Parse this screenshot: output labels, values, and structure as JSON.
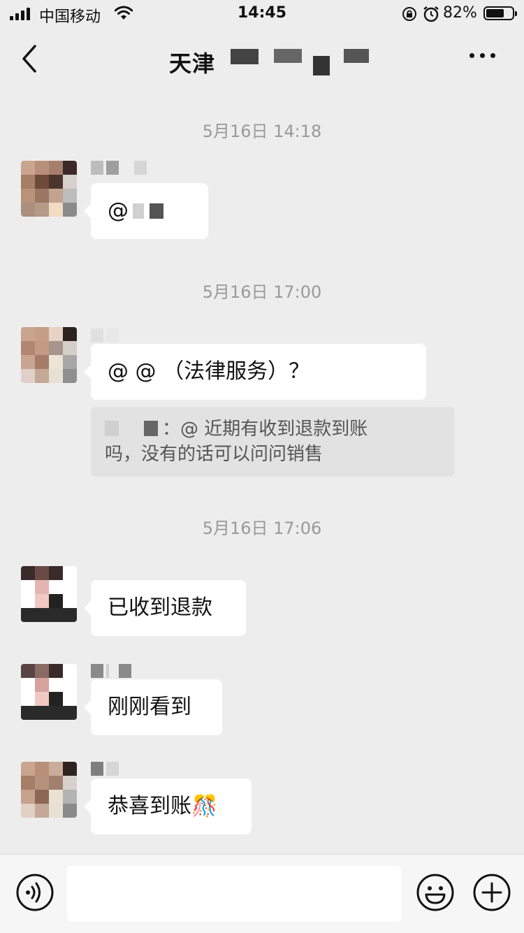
{
  "status_bar": {
    "carrier": "中国移动",
    "time": "14:45",
    "battery": "82%",
    "battery_level": 0.82
  },
  "header": {
    "title": "天津",
    "back_icon": "chevron-left-icon",
    "more_icon": "more-dots-icon"
  },
  "messages": [
    {
      "timestamp": "5月16日 14:18",
      "text": "@"
    },
    {
      "timestamp": "5月16日 17:00",
      "text": "@      @     （法律服务）？",
      "quote": {
        "line1": "：@      近期有收到退款到账",
        "line2": "吗，没有的话可以问问销售"
      }
    },
    {
      "timestamp": "5月16日 17:06",
      "text": "已收到退款"
    },
    {
      "text": "刚刚看到"
    },
    {
      "text": "恭喜到账🎊"
    }
  ],
  "input_bar": {
    "placeholder": "",
    "voice_icon": "voice-icon",
    "emoji_icon": "emoji-icon",
    "plus_icon": "plus-icon"
  },
  "colors": {
    "background": "#ededed",
    "bubble": "#ffffff",
    "quote": "#e2e2e2",
    "timestamp": "#9a9a9a"
  }
}
